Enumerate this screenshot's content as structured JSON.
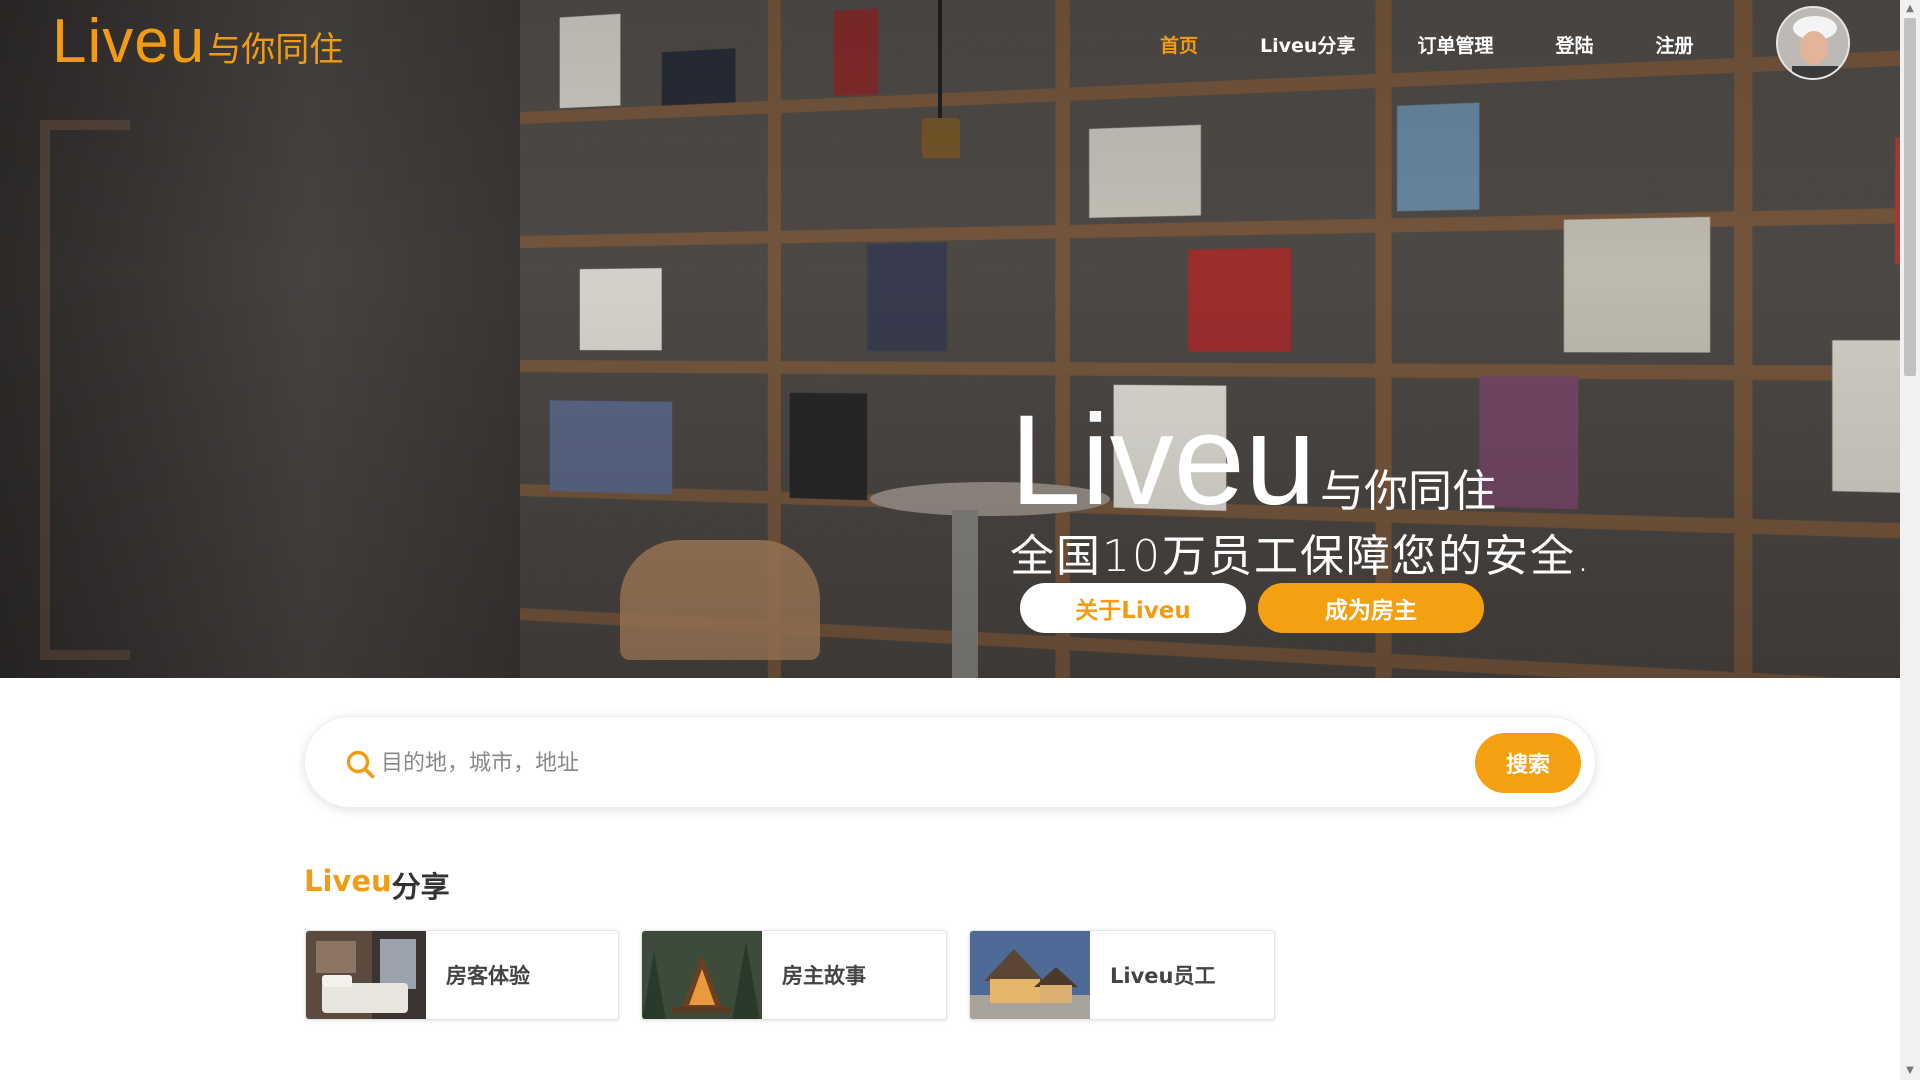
{
  "brand": {
    "logo_en": "Liveu",
    "logo_cn": "与你同住"
  },
  "nav": {
    "items": [
      {
        "label": "首页",
        "active": true
      },
      {
        "label": "Liveu分享",
        "active": false
      },
      {
        "label": "订单管理",
        "active": false
      },
      {
        "label": "登陆",
        "active": false
      },
      {
        "label": "注册",
        "active": false
      }
    ]
  },
  "hero": {
    "title_en": "Liveu",
    "title_cn": "与你同住",
    "subtitle": "全国10万员工保障您的安全.",
    "btn_about": "关于Liveu",
    "btn_host": "成为房主"
  },
  "search": {
    "placeholder": "目的地，城市，地址",
    "button": "搜索"
  },
  "share_section": {
    "title_en": "Liveu",
    "title_cn": "分享",
    "cards": [
      {
        "label": "房客体验",
        "icon": "bedroom-photo"
      },
      {
        "label": "房主故事",
        "icon": "cabin-forest-photo"
      },
      {
        "label": "Liveu员工",
        "icon": "house-dusk-photo"
      }
    ]
  },
  "colors": {
    "accent": "#f39c12",
    "button": "#f5a011"
  }
}
